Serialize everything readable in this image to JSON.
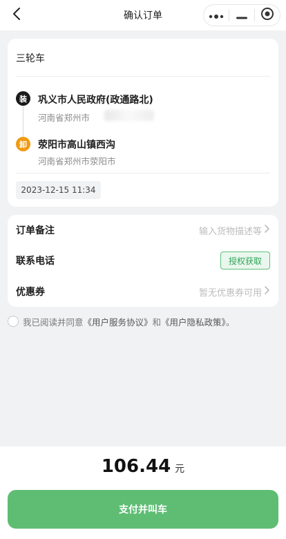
{
  "navbar": {
    "title": "确认订单",
    "back_icon": "chevron-left-icon",
    "more_icon": "more-dots-icon",
    "minimize_icon": "minimize-icon",
    "close_icon": "target-close-icon"
  },
  "route": {
    "vehicle_type": "三轮车",
    "load": {
      "badge": "装",
      "name": "巩义市人民政府(政通路北)",
      "address": "河南省郑州市",
      "color": "#1a1a1a"
    },
    "unload": {
      "badge": "卸",
      "name": "荥阳市高山镇西沟",
      "address": "河南省郑州市荥阳市",
      "color": "#f19a12"
    },
    "time": "2023-12-15 11:34"
  },
  "info": {
    "remark": {
      "label": "订单备注",
      "placeholder": "输入货物描述等"
    },
    "phone": {
      "label": "联系电话",
      "button": "授权获取"
    },
    "coupon": {
      "label": "优惠券",
      "value": "暂无优惠券可用"
    }
  },
  "agreement": {
    "prefix": "我已阅读并同意",
    "service": "《用户服务协议》",
    "and": "和",
    "privacy": "《用户隐私政策》",
    "suffix": "。"
  },
  "footer": {
    "amount": "106.44",
    "unit": "元",
    "pay_button": "支付并叫车",
    "accent": "#5ebd73"
  }
}
